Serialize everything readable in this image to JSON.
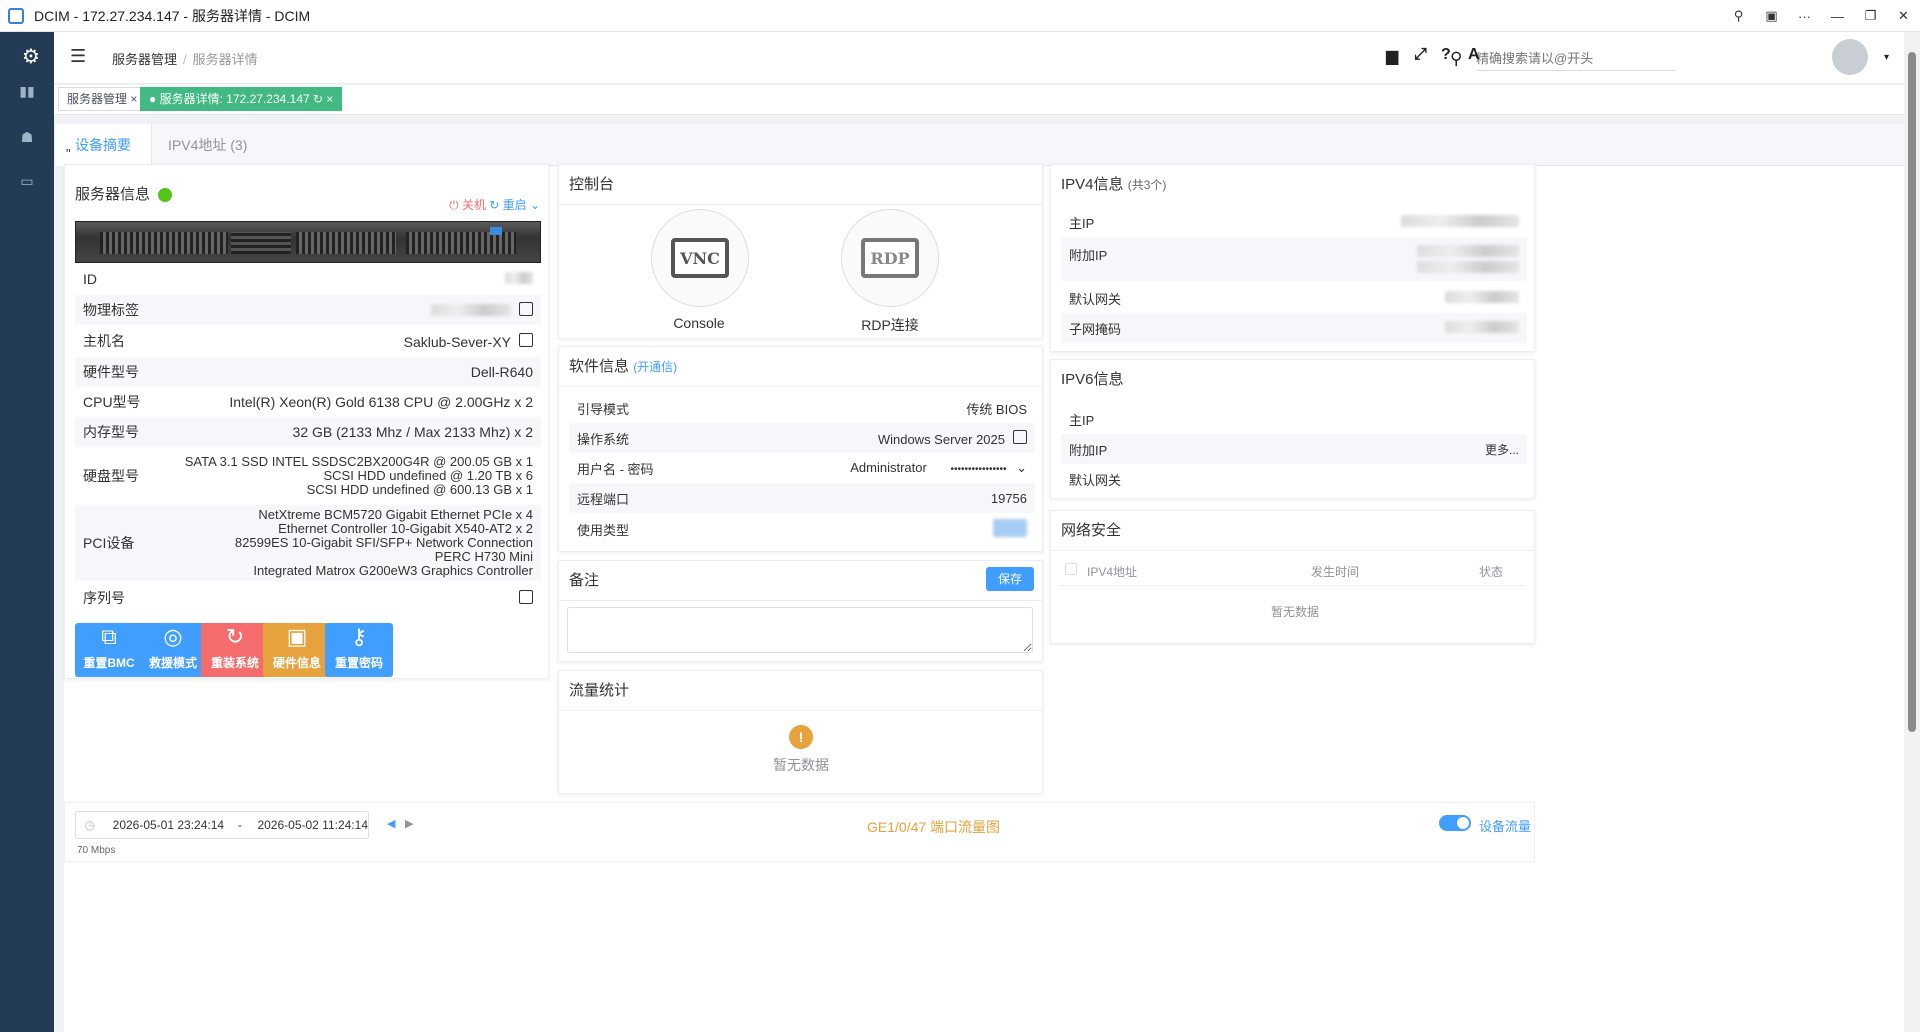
{
  "window": {
    "title": "DCIM - 172.27.234.147 - 服务器详情 - DCIM"
  },
  "header": {
    "breadcrumb": [
      "服务器管理",
      "服务器详情"
    ],
    "search_placeholder": "精确搜索请以@开头"
  },
  "tagsview": [
    "服务器管理",
    "服务器详情: 172.27.234.147"
  ],
  "tabs": [
    "设备摘要",
    "IPV4地址 (3)"
  ],
  "quote_mark": "\"",
  "server_info": {
    "title": "服务器信息",
    "status_color": "#52c41a",
    "shutdown": "关机",
    "reboot": "重启",
    "rows": [
      {
        "k": "ID",
        "v": ""
      },
      {
        "k": "物理标签",
        "v": ""
      },
      {
        "k": "主机名",
        "v": "Saklub-Sever-XY"
      },
      {
        "k": "硬件型号",
        "v": "Dell-R640"
      },
      {
        "k": "CPU型号",
        "v": "Intel(R) Xeon(R) Gold 6138 CPU @ 2.00GHz x 2"
      },
      {
        "k": "内存型号",
        "v": "32 GB (2133 Mhz / Max 2133 Mhz) x 2"
      },
      {
        "k": "硬盘型号",
        "v": [
          "SATA 3.1 SSD INTEL SSDSC2BX200G4R @ 200.05 GB x 1",
          "SCSI HDD undefined @ 1.20 TB x 6",
          "SCSI HDD undefined @ 600.13 GB x 1"
        ]
      },
      {
        "k": "PCI设备",
        "v": [
          "NetXtreme BCM5720 Gigabit Ethernet PCIe x 4",
          "Ethernet Controller 10-Gigabit X540-AT2 x 2",
          "82599ES 10-Gigabit SFI/SFP+ Network Connection",
          "PERC H730 Mini",
          "Integrated Matrox G200eW3 Graphics Controller"
        ]
      },
      {
        "k": "序列号",
        "v": ""
      }
    ],
    "actions": [
      {
        "label": "重置BMC",
        "icon": "⧉",
        "color": "#409eff"
      },
      {
        "label": "救援模式",
        "icon": "◎",
        "color": "#409eff"
      },
      {
        "label": "重装系统",
        "icon": "↻",
        "color": "#f56c6c"
      },
      {
        "label": "硬件信息",
        "icon": "▣",
        "color": "#e6a23c"
      },
      {
        "label": "重置密码",
        "icon": "⚷",
        "color": "#409eff"
      }
    ]
  },
  "console": {
    "title": "控制台",
    "vnc_label": "Console",
    "vnc_text": "VNC",
    "rdp_label": "RDP连接",
    "rdp_text": "RDP"
  },
  "software": {
    "title": "软件信息",
    "link": "(开通信)",
    "rows": [
      {
        "k": "引导模式",
        "v": "传统 BIOS"
      },
      {
        "k": "操作系统",
        "v": "Windows Server 2025"
      },
      {
        "k": "用户名 - 密码",
        "v": "Administrator",
        "pwd": "••••••••••••••••"
      },
      {
        "k": "远程端口",
        "v": "19756"
      },
      {
        "k": "使用类型",
        "v": ""
      }
    ]
  },
  "remark": {
    "title": "备注",
    "save": "保存",
    "value": ""
  },
  "traffic": {
    "title": "流量统计",
    "empty": "暂无数据"
  },
  "ipv4": {
    "title": "IPV4信息",
    "count": "(共3个)",
    "rows": [
      "主IP",
      "附加IP",
      "默认网关",
      "子网掩码"
    ]
  },
  "ipv6": {
    "title": "IPV6信息",
    "rows": [
      "主IP",
      "附加IP",
      "默认网关"
    ],
    "more": "更多..."
  },
  "netsec": {
    "title": "网络安全",
    "cols": [
      "IPV4地址",
      "发生时间",
      "状态"
    ],
    "empty": "暂无数据"
  },
  "bottom": {
    "start": "2026-05-01 23:24:14",
    "dash": "-",
    "end": "2026-05-02 11:24:14",
    "chart_title": "GE1/0/47 端口流量图",
    "toggle_label": "设备流量",
    "yaxis": "70 Mbps",
    "accent": "#e6a23c"
  }
}
